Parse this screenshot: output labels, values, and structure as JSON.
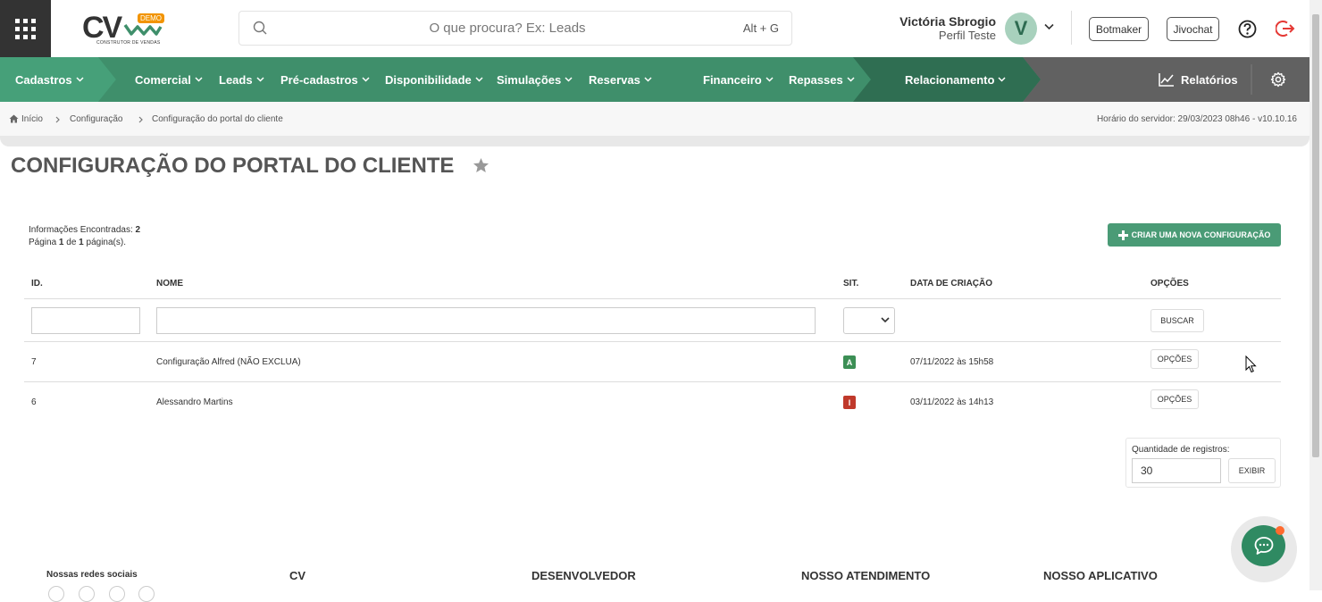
{
  "header": {
    "logo_text": "CV",
    "logo_badge": "DEMO",
    "logo_subtitle": "CONSTRUTOR DE VENDAS",
    "search_placeholder": "O que procura? Ex: Leads",
    "search_shortcut": "Alt + G",
    "user_name": "Victória Sbrogio",
    "user_profile": "Perfil Teste",
    "avatar_initial": "V",
    "botmaker_label": "Botmaker",
    "jivochat_label": "Jivochat"
  },
  "nav": {
    "items": [
      "Cadastros",
      "Comercial",
      "Leads",
      "Pré-cadastros",
      "Disponibilidade",
      "Simulações",
      "Reservas",
      "Financeiro",
      "Repasses",
      "Relacionamento"
    ],
    "reports_label": "Relatórios",
    "colors": {
      "primary": "#3f8f6b",
      "secondary": "#46a079",
      "dark": "#2f6e52",
      "gray": "#616161"
    }
  },
  "breadcrumb": {
    "items": [
      "Início",
      "Configuração",
      "Configuração do portal do cliente"
    ],
    "server_time": "Horário do servidor: 29/03/2023 08h46 - v10.10.16"
  },
  "page": {
    "title": "CONFIGURAÇÃO DO PORTAL DO CLIENTE",
    "info_found_label": "Informações Encontradas:",
    "info_found_count": "2",
    "page_label_prefix": "Página",
    "page_current": "1",
    "page_label_mid": "de",
    "page_total": "1",
    "page_label_suffix": "página(s).",
    "create_button": "CRIAR UMA NOVA CONFIGURAÇÃO"
  },
  "table": {
    "columns": [
      "ID.",
      "NOME",
      "SIT.",
      "DATA DE CRIAÇÃO",
      "OPÇÕES"
    ],
    "search_button": "BUSCAR",
    "options_button": "OPÇÕES",
    "rows": [
      {
        "id": "7",
        "name": "Configuração Alfred (NÃO EXCLUA)",
        "status": "A",
        "status_color": "#3c8f55",
        "created": "07/11/2022 às 15h58"
      },
      {
        "id": "6",
        "name": "Alessandro Martins",
        "status": "I",
        "status_color": "#c0392b",
        "created": "03/11/2022 às 14h13"
      }
    ]
  },
  "records": {
    "label": "Quantidade de registros:",
    "value": "30",
    "button": "EXIBIR"
  },
  "footer": {
    "social": "Nossas redes sociais",
    "cv": "CV",
    "developer": "DESENVOLVEDOR",
    "support": "NOSSO ATENDIMENTO",
    "app": "NOSSO APLICATIVO"
  }
}
